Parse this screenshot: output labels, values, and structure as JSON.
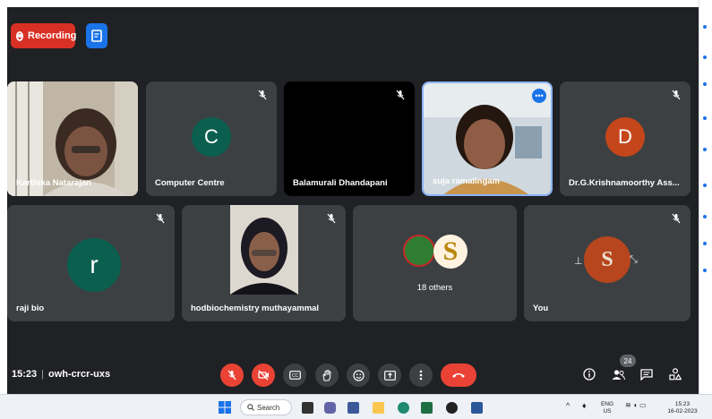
{
  "recording": {
    "label": "Recording"
  },
  "participants": [
    {
      "name": "Karthika Natarajan"
    },
    {
      "name": "Computer Centre",
      "initial": "C"
    },
    {
      "name": "Balamurali Dhandapani"
    },
    {
      "name": "suja ramalingam"
    },
    {
      "name": "Dr.G.Krishnamoorthy Ass...",
      "initial": "D"
    },
    {
      "name": "raji bio",
      "initial": "r"
    },
    {
      "name": "hodbiochemistry muthayammal"
    },
    {
      "name": "18 others"
    },
    {
      "name": "You"
    }
  ],
  "colors": {
    "teal": "#0b5f4e",
    "orange": "#c5461b",
    "red": "#ea4335",
    "blue": "#1a73e8",
    "tile": "#3c4043",
    "bg": "#202124"
  },
  "controls": {
    "time": "15:23",
    "meeting_code": "owh-crcr-uxs",
    "people_count": "24"
  },
  "taskbar": {
    "search_label": "Search",
    "lang_top": "ENG",
    "lang_bottom": "US",
    "time": "15:23",
    "date": "16-02-2023"
  }
}
